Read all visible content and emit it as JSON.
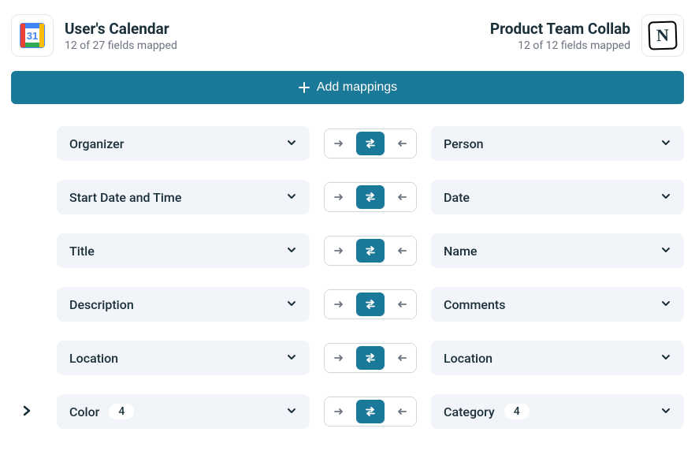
{
  "left": {
    "title": "User's Calendar",
    "sub": "12 of 27 fields mapped",
    "icon_name": "google-calendar-icon"
  },
  "right": {
    "title": "Product Team Collab",
    "sub": "12 of 12 fields mapped",
    "icon_name": "notion-icon",
    "icon_text": "N"
  },
  "add_button": "Add mappings",
  "mappings": [
    {
      "left": "Organizer",
      "right": "Person",
      "expandable": false,
      "left_badge": "",
      "right_badge": ""
    },
    {
      "left": "Start Date and Time",
      "right": "Date",
      "expandable": false,
      "left_badge": "",
      "right_badge": ""
    },
    {
      "left": "Title",
      "right": "Name",
      "expandable": false,
      "left_badge": "",
      "right_badge": ""
    },
    {
      "left": "Description",
      "right": "Comments",
      "expandable": false,
      "left_badge": "",
      "right_badge": ""
    },
    {
      "left": "Location",
      "right": "Location",
      "expandable": false,
      "left_badge": "",
      "right_badge": ""
    },
    {
      "left": "Color",
      "right": "Category",
      "expandable": true,
      "left_badge": "4",
      "right_badge": "4"
    }
  ]
}
